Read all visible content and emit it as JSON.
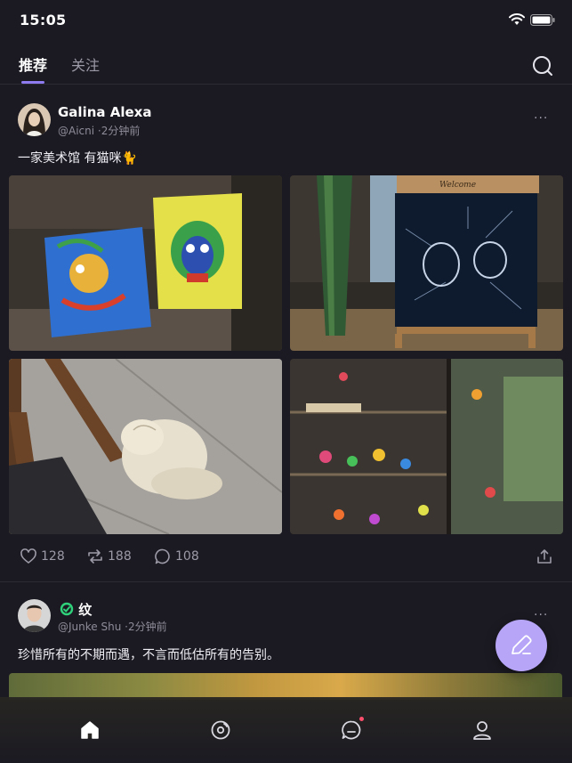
{
  "status": {
    "time": "15:05"
  },
  "tabs": [
    {
      "label": "推荐",
      "active": true
    },
    {
      "label": "关注",
      "active": false
    }
  ],
  "icons": {
    "search": "search-icon",
    "more": "more-icon",
    "like": "heart-icon",
    "repost": "repost-icon",
    "comment": "comment-icon",
    "share": "share-icon",
    "compose": "pencil-icon"
  },
  "posts": [
    {
      "author": "Galina Alexa",
      "handle": "@Aicni",
      "time": "·2分钟前",
      "text": "一家美术馆  有猫咪🐈",
      "more": "···",
      "photos": [
        "clay dragon paintings in display case",
        "vase and framed engraving with Welcome sign",
        "white fluffy cat sleeping on floor",
        "glass cabinet with colorful sculptures"
      ],
      "likes": "128",
      "reposts": "188",
      "comments": "108"
    },
    {
      "author": "纹",
      "handle": "@Junke Shu",
      "time": "·2分钟前",
      "text": "珍惜所有的不期而遇，不言而低估所有的告别。",
      "more": "···"
    }
  ],
  "photo_sign": "Welcome",
  "nav": [
    {
      "name": "home",
      "active": true
    },
    {
      "name": "discover",
      "active": false
    },
    {
      "name": "messages",
      "active": false,
      "badge": true
    },
    {
      "name": "profile",
      "active": false
    }
  ],
  "colors": {
    "background": "#1b1a22",
    "accent": "#8f7bf0",
    "fab": "#b7a6f8",
    "badge": "#ff4f6d",
    "verified": "#2fd17a"
  }
}
